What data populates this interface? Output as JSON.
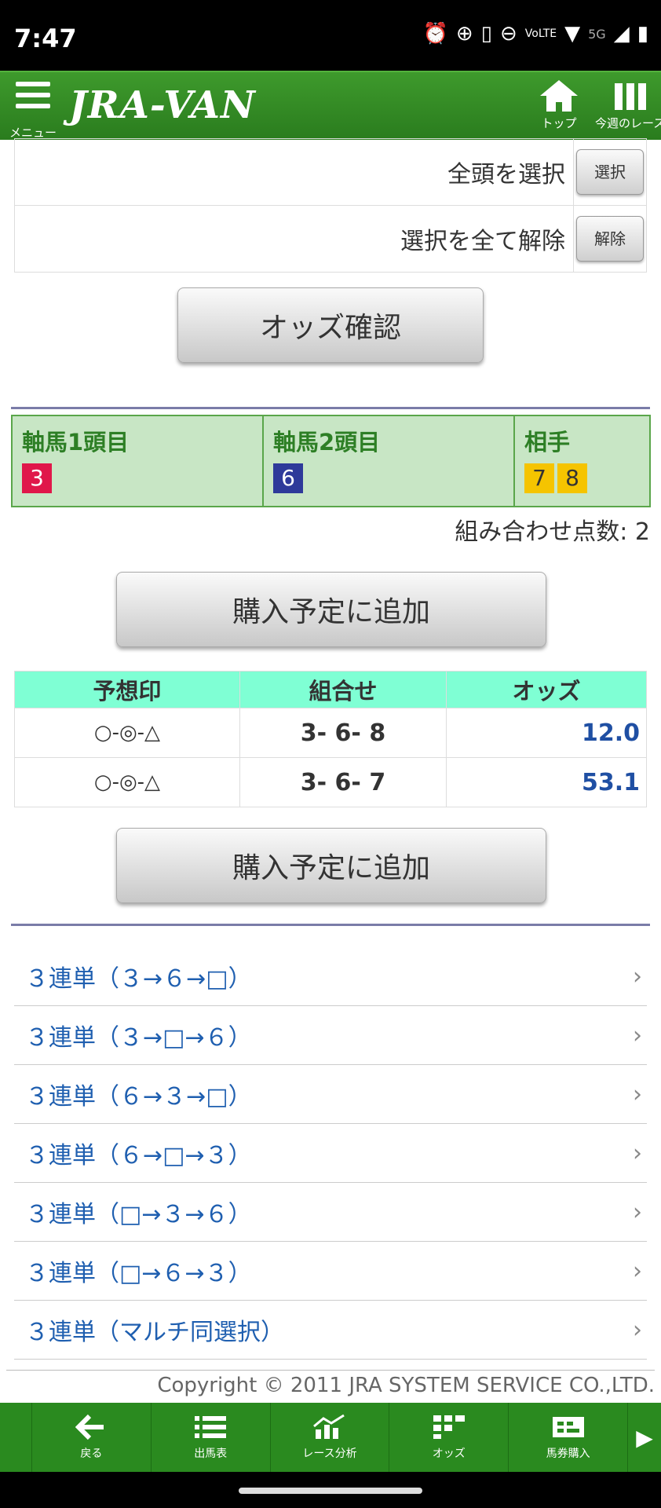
{
  "status_bar": {
    "time": "7:47",
    "network": "5G"
  },
  "header": {
    "menu_label": "メニュー",
    "logo_text": "JRA-VAN",
    "top_label": "トップ",
    "week_label": "今週のレース"
  },
  "selection": {
    "select_all_label": "全頭を選択",
    "select_all_button": "選択",
    "clear_all_label": "選択を全て解除",
    "clear_all_button": "解除"
  },
  "odds_check_button": "オッズ確認",
  "axis": {
    "col1_title": "軸馬1頭目",
    "col1_horses": [
      "3"
    ],
    "col2_title": "軸馬2頭目",
    "col2_horses": [
      "6"
    ],
    "col3_title": "相手",
    "col3_horses": [
      "7",
      "8"
    ],
    "colors": {
      "horse3": "#e0174a",
      "horse6": "#2e3a9a",
      "partner": "#f5c400"
    }
  },
  "combination_count": "組み合わせ点数: 2",
  "add_button_label": "購入予定に追加",
  "results": {
    "headers": [
      "予想印",
      "組合せ",
      "オッズ"
    ],
    "rows": [
      {
        "mark": "○-◎-△",
        "combo": "3- 6- 8",
        "odds": "12.0"
      },
      {
        "mark": "○-◎-△",
        "combo": "3- 6- 7",
        "odds": "53.1"
      }
    ]
  },
  "links": [
    "３連単（３→６→□）",
    "３連単（３→□→６）",
    "３連単（６→３→□）",
    "３連単（６→□→３）",
    "３連単（□→３→６）",
    "３連単（□→６→３）",
    "３連単（マルチ同選択）"
  ],
  "chevron": "›",
  "copyright": "Copyright © 2011 JRA SYSTEM SERVICE CO.,LTD.",
  "bottom_nav": {
    "back": "戻る",
    "race_card": "出馬表",
    "race_analysis": "レース分析",
    "odds": "オッズ",
    "ticket": "馬券購入"
  }
}
